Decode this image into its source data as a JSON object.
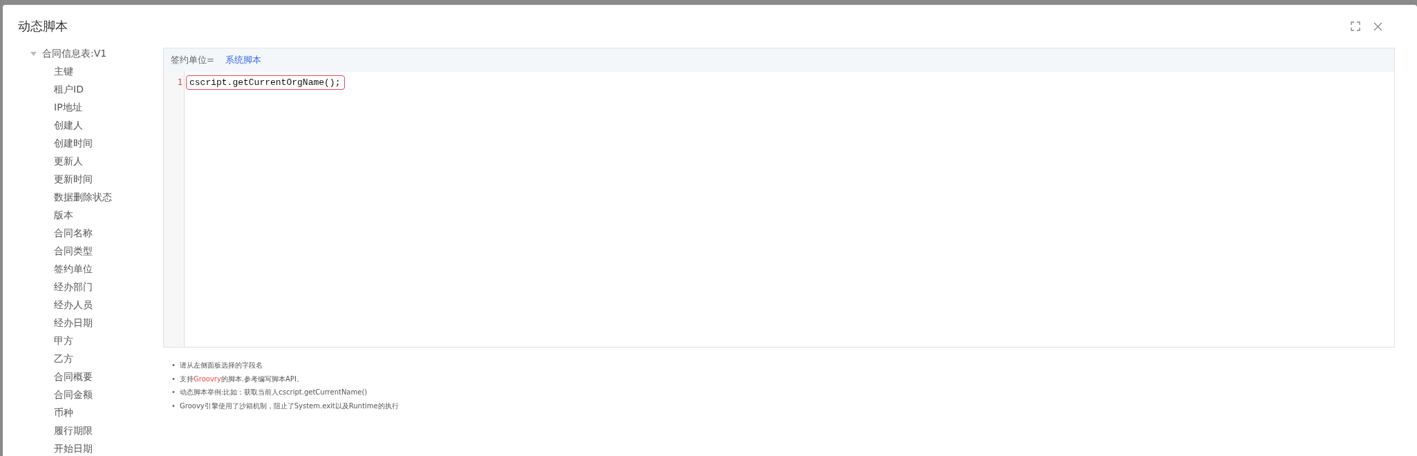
{
  "dialog": {
    "title": "动态脚本"
  },
  "tree": {
    "label": "合同信息表:V1",
    "expanded": true,
    "children": [
      {
        "label": "主键"
      },
      {
        "label": "租户ID"
      },
      {
        "label": "IP地址"
      },
      {
        "label": "创建人"
      },
      {
        "label": "创建时间"
      },
      {
        "label": "更新人"
      },
      {
        "label": "更新时间"
      },
      {
        "label": "数据删除状态"
      },
      {
        "label": "版本"
      },
      {
        "label": "合同名称"
      },
      {
        "label": "合同类型"
      },
      {
        "label": "签约单位"
      },
      {
        "label": "经办部门"
      },
      {
        "label": "经办人员"
      },
      {
        "label": "经办日期"
      },
      {
        "label": "甲方"
      },
      {
        "label": "乙方"
      },
      {
        "label": "合同概要"
      },
      {
        "label": "合同金额"
      },
      {
        "label": "币种"
      },
      {
        "label": "履行期限"
      },
      {
        "label": "开始日期"
      }
    ]
  },
  "editor": {
    "field_label": "签约单位=",
    "link": "系统脚本",
    "lines": [
      {
        "number": "1",
        "code": "cscript.getCurrentOrgName();"
      }
    ]
  },
  "notes": [
    {
      "bullet": "•",
      "parts": [
        {
          "text": "请从左侧面板选择的字段名",
          "highlight": false
        }
      ]
    },
    {
      "bullet": "•",
      "parts": [
        {
          "text": "支持",
          "highlight": false
        },
        {
          "text": "Groovry",
          "highlight": true
        },
        {
          "text": "的脚本.参考编写脚本API。",
          "highlight": false
        }
      ]
    },
    {
      "bullet": "•",
      "parts": [
        {
          "text": "动态脚本举例:比如：获取当前人cscript.getCurrentName()",
          "highlight": false
        }
      ]
    },
    {
      "bullet": "•",
      "parts": [
        {
          "text": "Groovy引擎使用了沙箱机制，阻止了System.exit以及Runtime的执行",
          "highlight": false
        }
      ]
    }
  ]
}
